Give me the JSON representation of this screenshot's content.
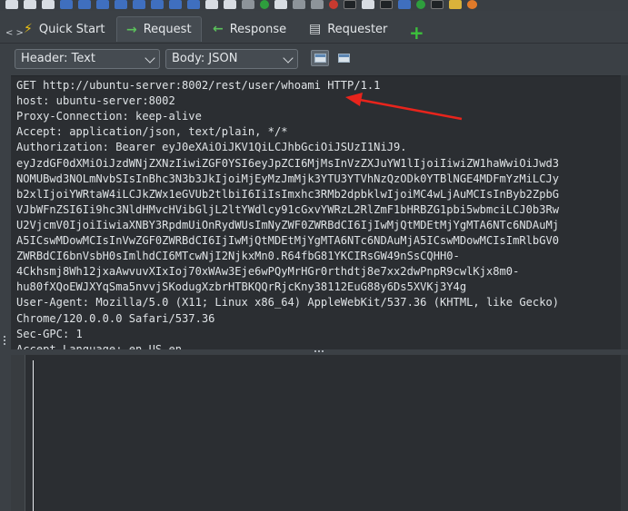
{
  "tabs": [
    {
      "label": "Quick Start",
      "icon": "lightning-icon"
    },
    {
      "label": "Request",
      "icon": "arrow-right-icon"
    },
    {
      "label": "Response",
      "icon": "arrow-left-icon"
    },
    {
      "label": "Requester",
      "icon": "requester-icon"
    }
  ],
  "add_tab": "+",
  "collapse_glyph": "< >",
  "toolbar": {
    "header_select": "Header: Text",
    "body_select": "Body: JSON"
  },
  "request_lines": [
    "GET http://ubuntu-server:8002/rest/user/whoami HTTP/1.1",
    "host: ubuntu-server:8002",
    "Proxy-Connection: keep-alive",
    "Accept: application/json, text/plain, */*",
    "Authorization: Bearer eyJ0eXAiOiJKV1QiLCJhbGciOiJSUzI1NiJ9.",
    "eyJzdGF0dXMiOiJzdWNjZXNzIiwiZGF0YSI6eyJpZCI6MjMsInVzZXJuYW1lIjoiIiwiZW1haWwiOiJwd3",
    "NOMUBwd3NOLmNvbSIsInBhc3N3b3JkIjoiMjEyMzJmMjk3YTU3YTVhNzQzODk0YTBlNGE4MDFmYzMiLCJy",
    "b2xlIjoiYWRtaW4iLCJkZWx1eGVUb2tlbiI6IiIsImxhc3RMb2dpbklwIjoiMC4wLjAuMCIsInByb2ZpbG",
    "VJbWFnZSI6Ii9hc3NldHMvcHVibGljL2ltYWdlcy91cGxvYWRzL2RlZmF1bHRBZG1pbi5wbmciLCJ0b3Rw",
    "U2VjcmV0IjoiIiwiaXNBY3RpdmUiOnRydWUsImNyZWF0ZWRBdCI6IjIwMjQtMDEtMjYgMTA6NTc6NDAuMj",
    "A5ICswMDowMCIsInVwZGF0ZWRBdCI6IjIwMjQtMDEtMjYgMTA6NTc6NDAuMjA5ICswMDowMCIsImRlbGV0",
    "ZWRBdCI6bnVsbH0sImlhdCI6MTcwNjI2NjkxMn0.R64fbG81YKCIRsGW49nSsCQHH0-",
    "4Ckhsmj8Wh12jxaAwvuvXIxIoj70xWAw3Eje6wPQyMrHGr0rthdtj8e7xx2dwPnpR9cwlKjx8m0-",
    "hu80fXQoEWJXYqSma5nvvjSKodugXzbrHTBKQQrRjcKny38112EuG88y6Ds5XVKj3Y4g",
    "User-Agent: Mozilla/5.0 (X11; Linux x86_64) AppleWebKit/537.36 (KHTML, like Gecko)",
    "Chrome/120.0.0.0 Safari/537.36",
    "Sec-GPC: 1",
    "Accept-Language: en-US,en"
  ],
  "colors": {
    "annotation_arrow": "#e8241c",
    "add_tab": "#3cc13c",
    "editor_bg": "#2b2e32"
  }
}
